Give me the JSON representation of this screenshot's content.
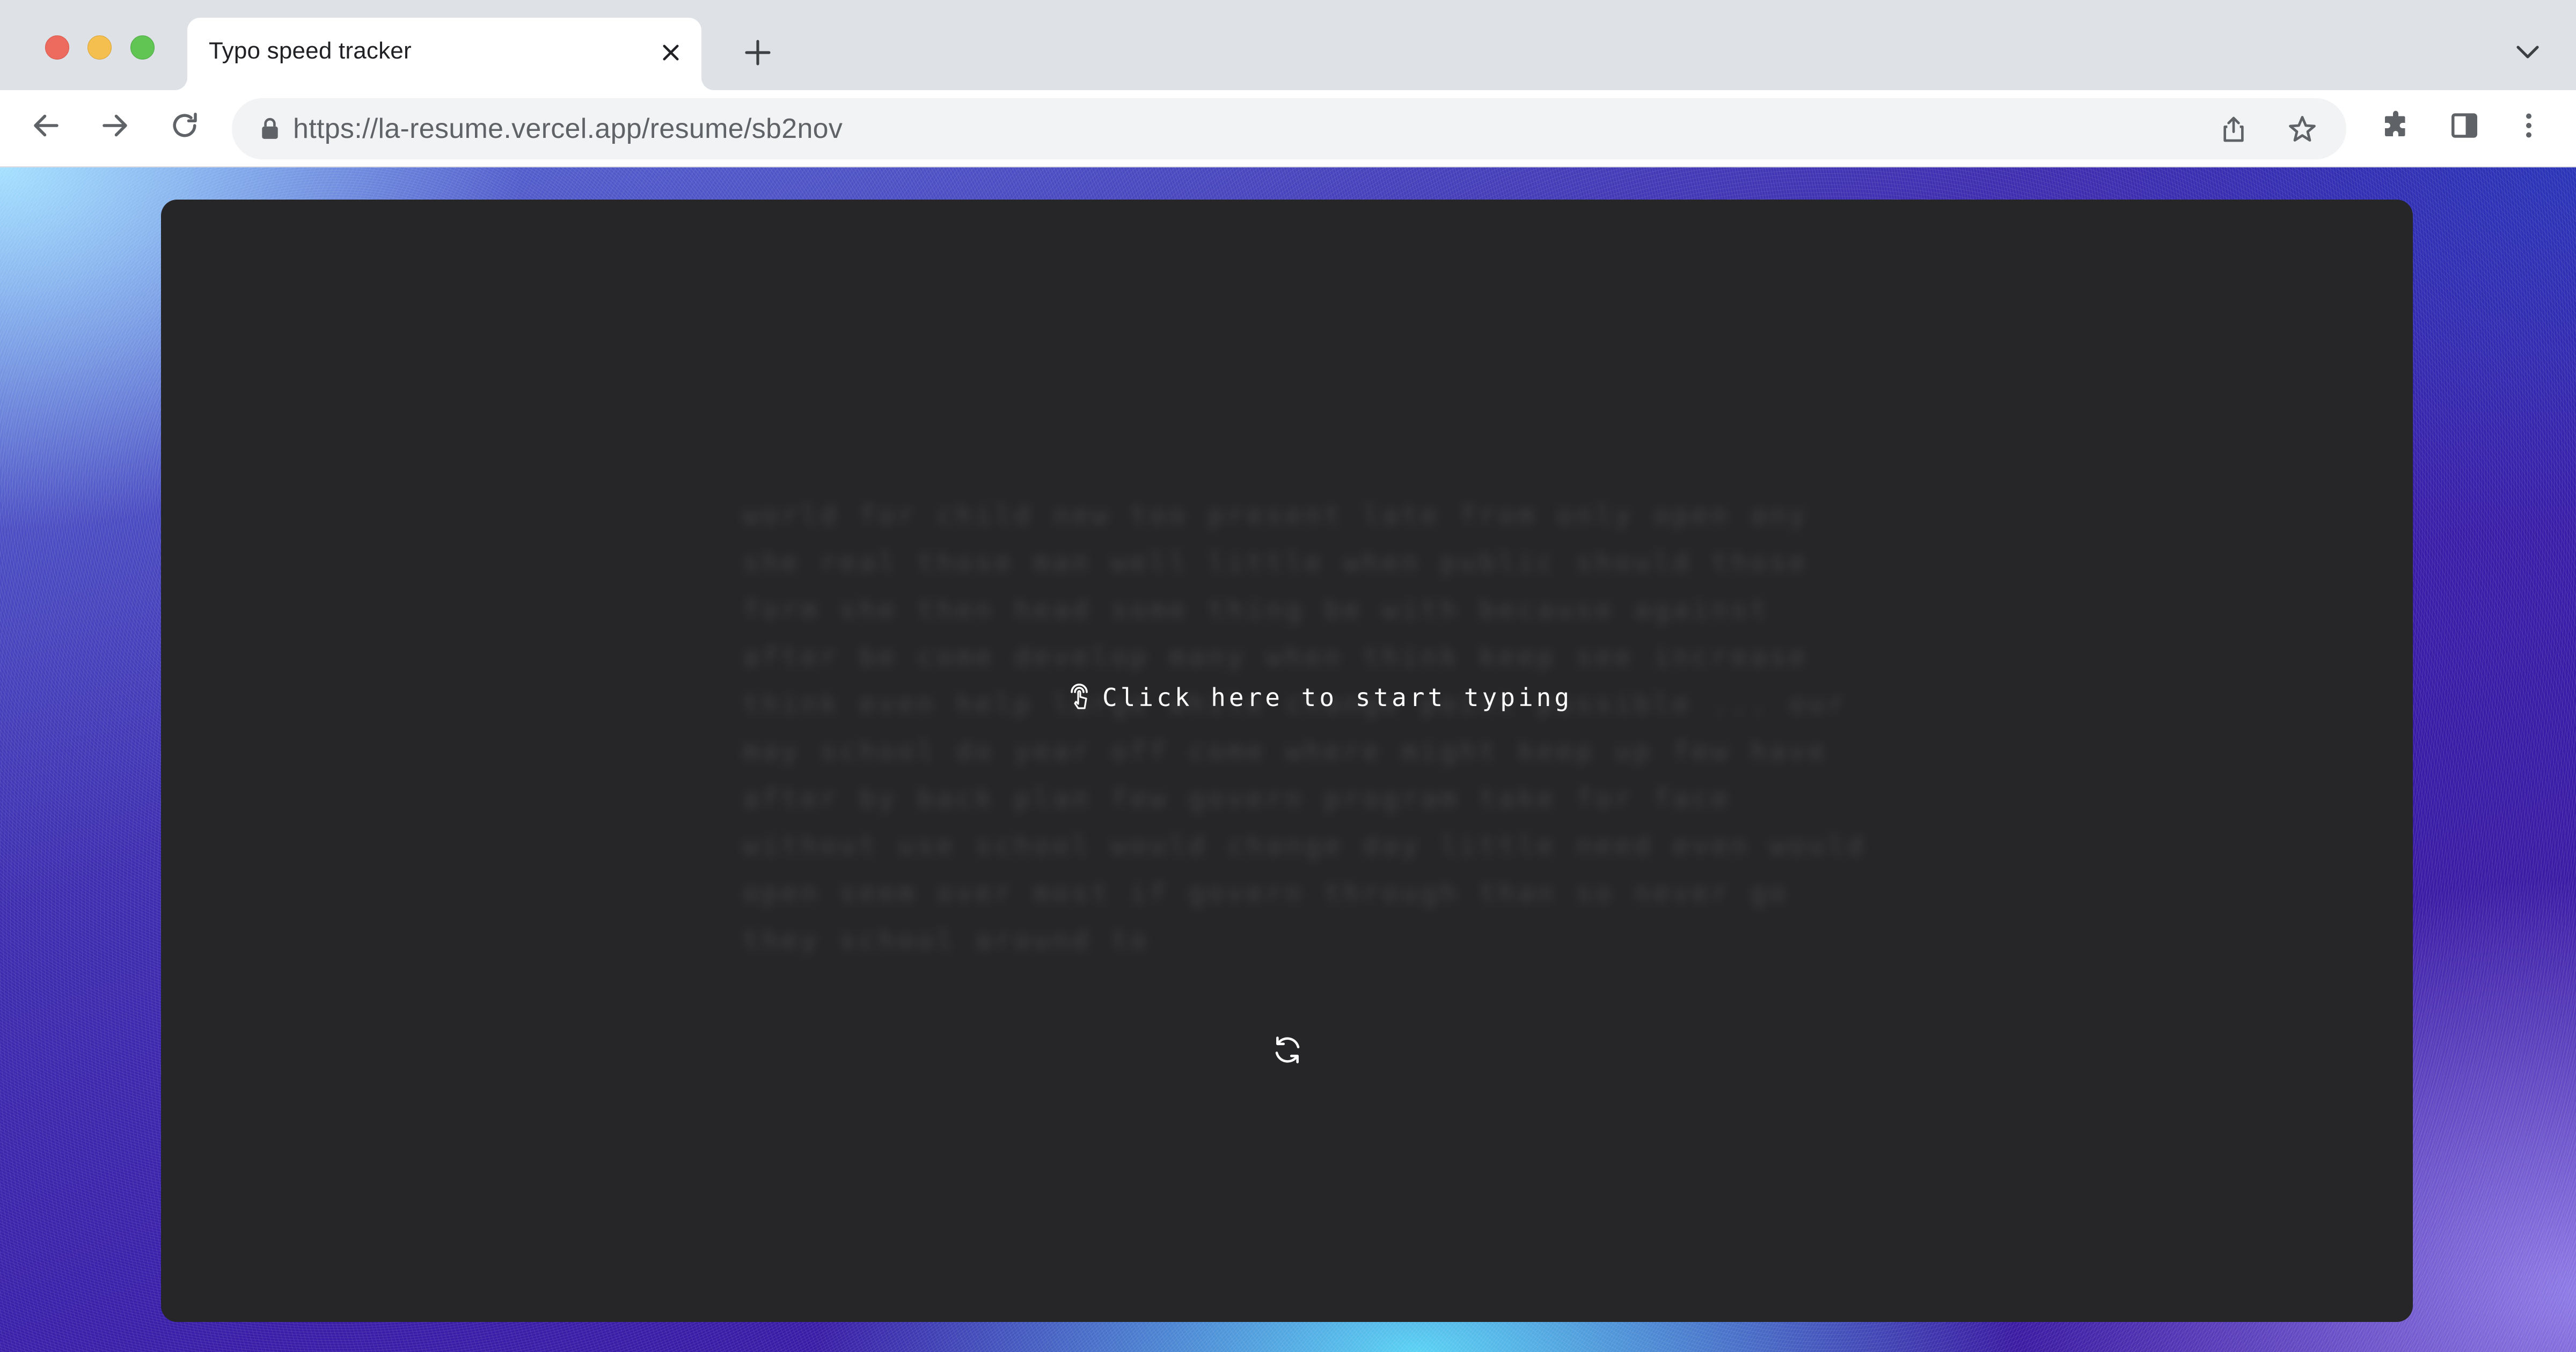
{
  "window": {
    "controls": [
      "close",
      "minimize",
      "zoom"
    ]
  },
  "tab": {
    "title": "Typo speed tracker"
  },
  "toolbar": {
    "url": "https://la-resume.vercel.app/resume/sb2nov"
  },
  "page": {
    "words": "world for child new too present late from only open any she real those man well little when public should those form she then head some thing be with because against after be come develop many when think keep see increase think even help large while change point possible ... our may school do year off come where might keep up few have after by back plan few govern program take for face without use school would change day little need even would open seem over most if govern through than so never go they school around to",
    "start_prompt": "Click here to start typing"
  },
  "colors": {
    "card_bg": "#262628",
    "prompt_text": "#ffffff",
    "chrome_bg": "#dee1e6"
  }
}
